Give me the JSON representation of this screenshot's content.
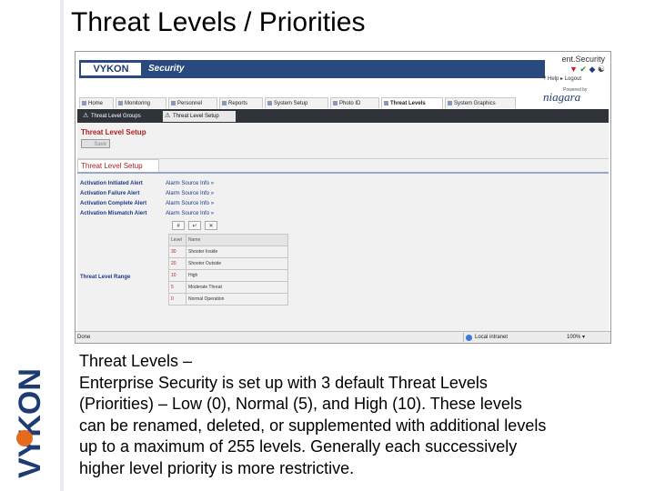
{
  "slide": {
    "title": "Threat Levels / Priorities",
    "side_logo_text": "VYKON",
    "body_lines": [
      "Threat Levels –",
      "Enterprise Security is set up with 3 default Threat Levels",
      "(Priorities) – Low (0), Normal (5), and High (10).  These levels",
      "can be renamed, deleted, or supplemented with additional levels",
      "up to a maximum of 255 levels.  Generally each successively",
      "higher level priority is more restrictive."
    ]
  },
  "app": {
    "logo": "VYKON",
    "brand": "Security",
    "product": "ent.Security",
    "help": "Help",
    "logout": "Logout",
    "powered_by": "Powered by",
    "niagara": "niagara",
    "nav_tabs": [
      "Home",
      "Monitoring",
      "Personnel",
      "Reports",
      "System Setup",
      "Photo ID",
      "Threat Levels",
      "System Graphics"
    ],
    "active_nav": "Threat Levels",
    "sub_tabs": [
      "Threat Level Groups",
      "Threat Level Setup"
    ],
    "active_sub": "Threat Level Setup",
    "page_heading": "Threat Level Setup",
    "save_label": "Save",
    "section_tab": "Threat Level Setup",
    "alerts": [
      {
        "label": "Activation Initiated Alert",
        "value": "Alarm Source Info »"
      },
      {
        "label": "Activation Failure Alert",
        "value": "Alarm Source Info »"
      },
      {
        "label": "Activation Complete Alert",
        "value": "Alarm Source Info »"
      },
      {
        "label": "Activation Mismatch Alert",
        "value": "Alarm Source Info »"
      }
    ],
    "range_label": "Threat Level Range",
    "grid_buttons": [
      "#",
      "↵",
      "✕"
    ],
    "table_headers": [
      "Level",
      "Name"
    ],
    "levels": [
      {
        "level": "30",
        "name": "Shooter Inside"
      },
      {
        "level": "20",
        "name": "Shooter Outside"
      },
      {
        "level": "10",
        "name": "High"
      },
      {
        "level": "5",
        "name": "Moderate Threat"
      },
      {
        "level": "0",
        "name": "Normal Operation"
      }
    ],
    "status": {
      "done": "Done",
      "zone": "Local intranet",
      "zoom": "100%"
    }
  },
  "colors": {
    "brand_bar": "#2a4a7f",
    "sub_bar": "#30343a",
    "heading_red": "#b02020",
    "link_blue": "#1d3a85"
  }
}
